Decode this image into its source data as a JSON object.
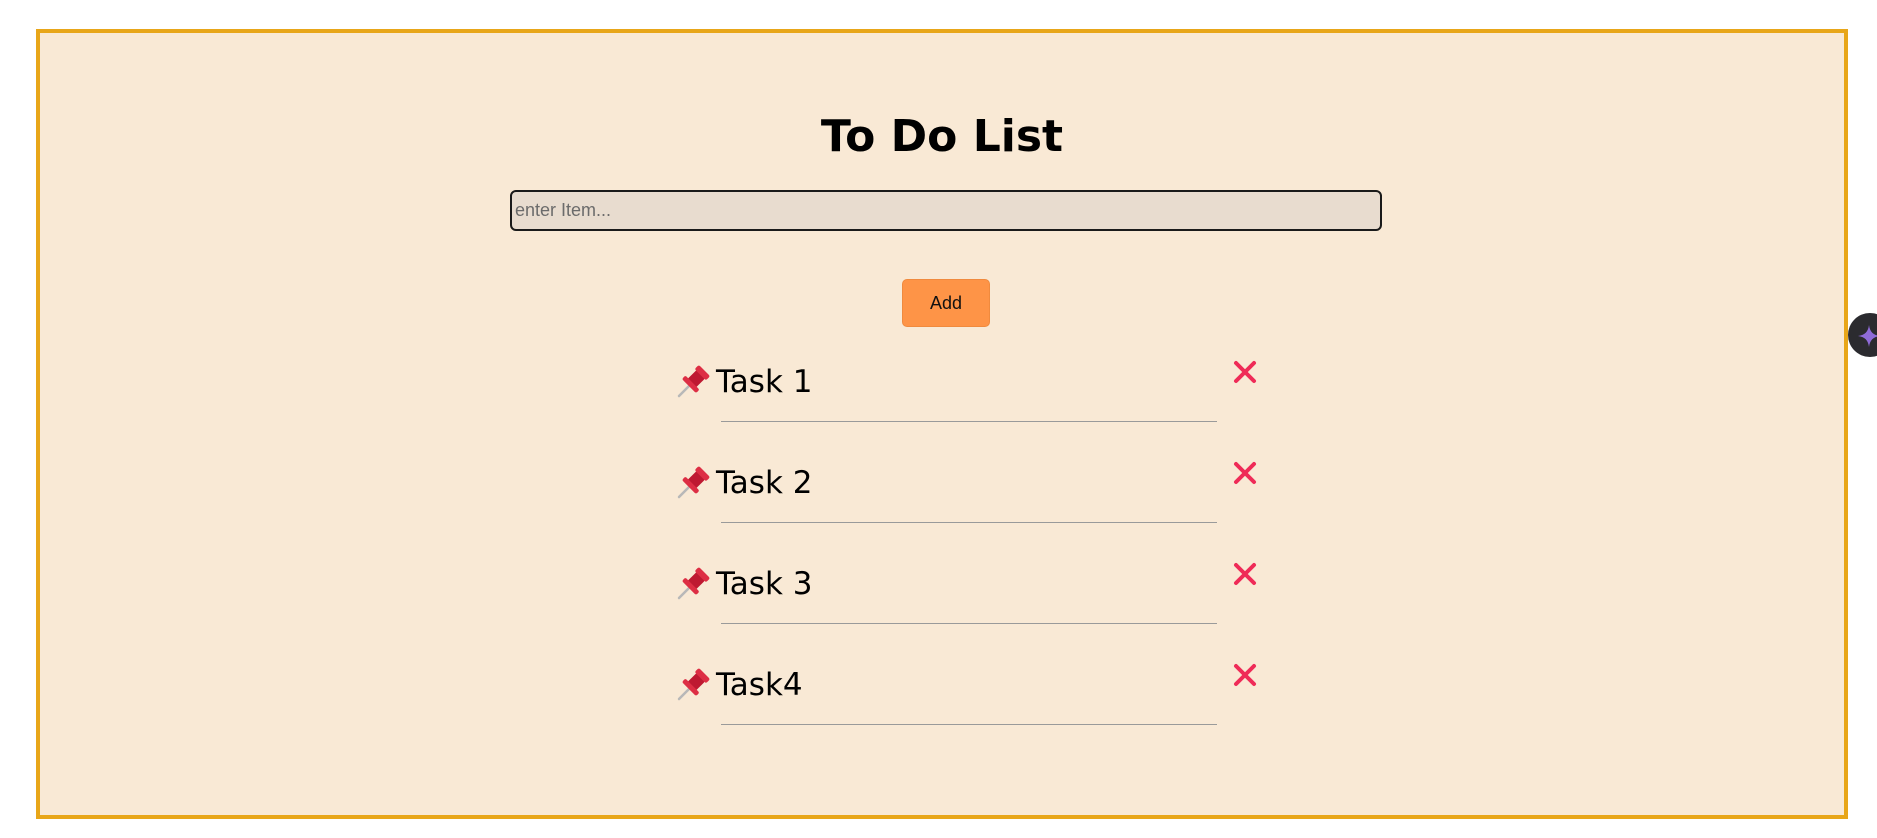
{
  "app": {
    "title": "To Do List"
  },
  "input": {
    "placeholder": "enter Item...",
    "value": ""
  },
  "add_button": {
    "label": "Add"
  },
  "tasks": [
    {
      "label": "Task 1",
      "icon": "pushpin-icon",
      "delete_icon": "close-icon"
    },
    {
      "label": "Task 2",
      "icon": "pushpin-icon",
      "delete_icon": "close-icon"
    },
    {
      "label": "Task 3",
      "icon": "pushpin-icon",
      "delete_icon": "close-icon"
    },
    {
      "label": "Task4",
      "icon": "pushpin-icon",
      "delete_icon": "close-icon"
    }
  ],
  "side_badge": {
    "icon": "sparkle-icon"
  },
  "colors": {
    "frame_border": "#e8a619",
    "background": "#f9e9d5",
    "input_background": "#e8dccf",
    "add_button": "#fe9447",
    "delete_icon": "#ef2b57",
    "divider": "#9a9a9a"
  }
}
